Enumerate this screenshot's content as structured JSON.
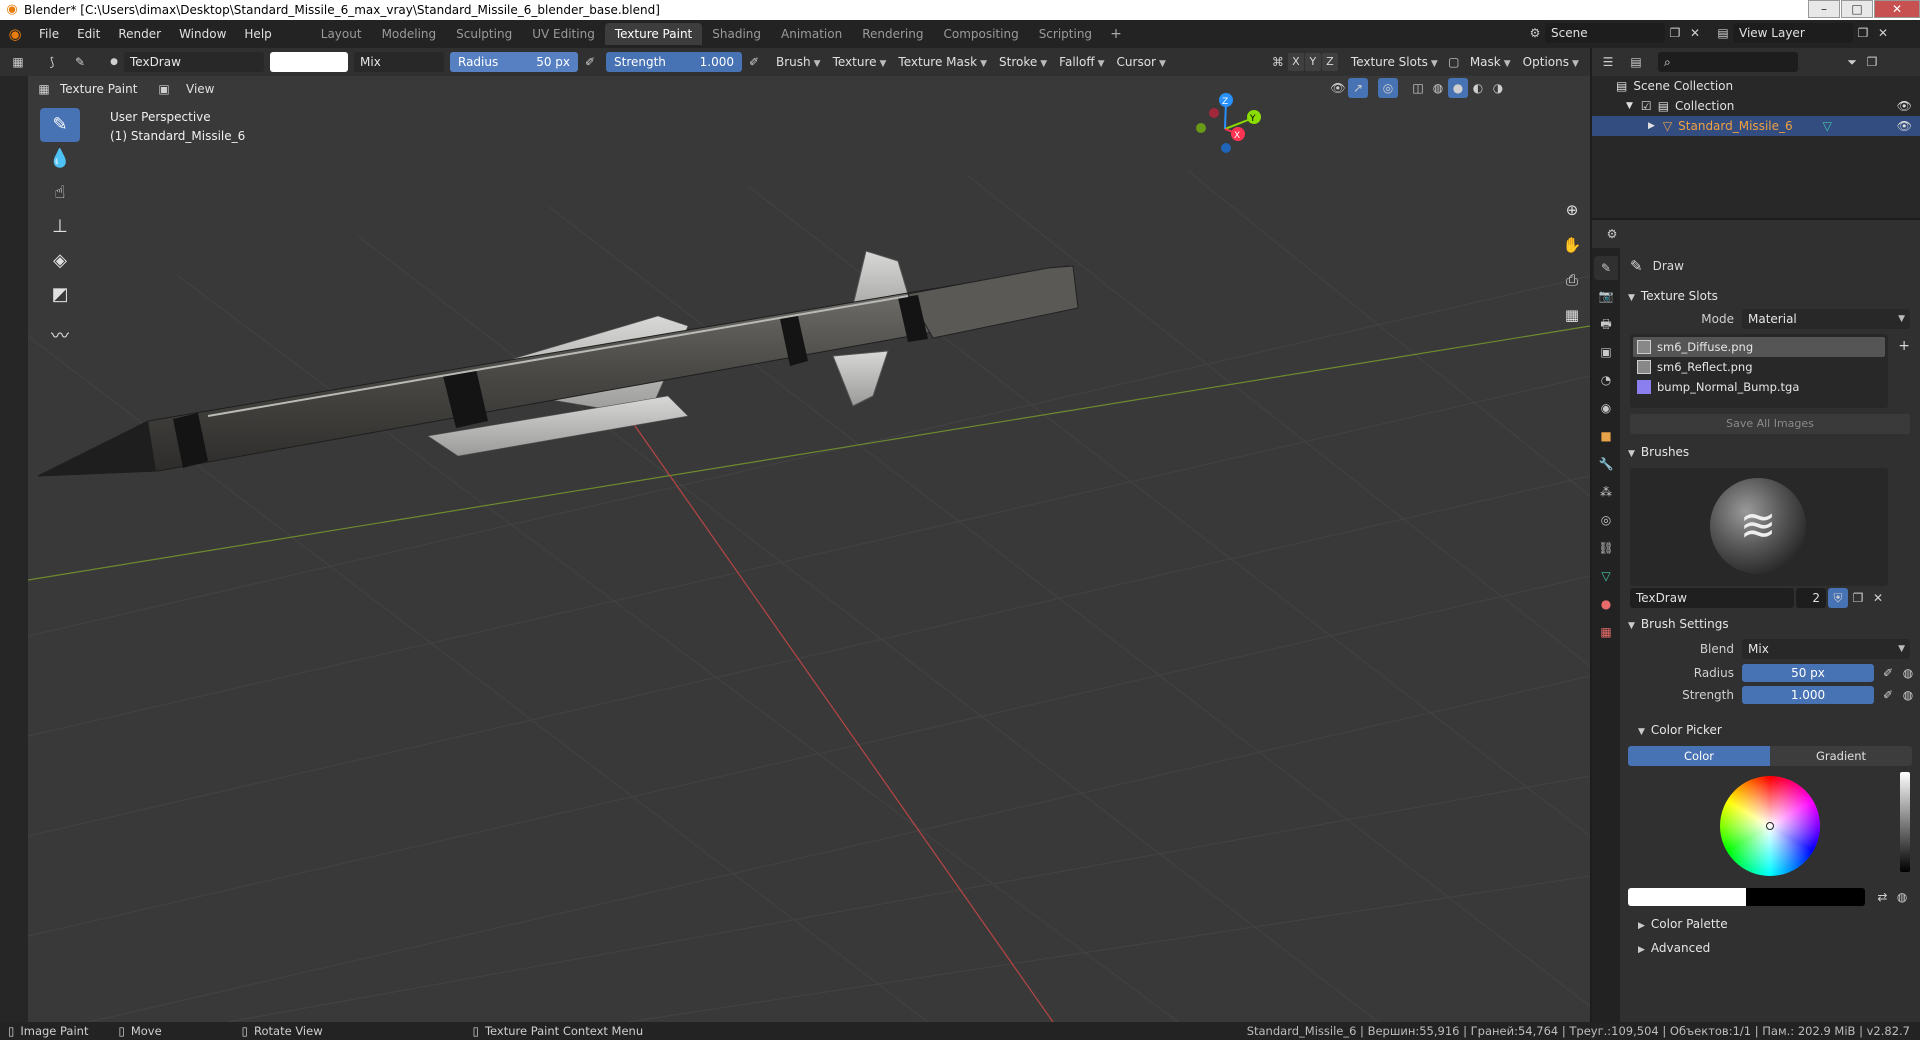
{
  "window": {
    "title": "Blender* [C:\\Users\\dimax\\Desktop\\Standard_Missile_6_max_vray\\Standard_Missile_6_blender_base.blend]",
    "btn_min": "–",
    "btn_max": "□",
    "btn_close": "✕"
  },
  "menu": {
    "items": [
      "File",
      "Edit",
      "Render",
      "Window",
      "Help"
    ]
  },
  "workspaces": {
    "tabs": [
      "Layout",
      "Modeling",
      "Sculpting",
      "UV Editing",
      "Texture Paint",
      "Shading",
      "Animation",
      "Rendering",
      "Compositing",
      "Scripting"
    ],
    "active": "Texture Paint",
    "add": "+"
  },
  "scene": {
    "name": "Scene",
    "view_layer": "View Layer"
  },
  "tool_header": {
    "brush_name": "TexDraw",
    "blend": "Mix",
    "radius_label": "Radius",
    "radius_value": "50 px",
    "strength_label": "Strength",
    "strength_value": "1.000",
    "menus": [
      "Brush",
      "Texture",
      "Texture Mask",
      "Stroke",
      "Falloff",
      "Cursor"
    ],
    "axes": [
      "X",
      "Y",
      "Z"
    ],
    "right_menus": [
      "Texture Slots",
      "Mask",
      "Options"
    ]
  },
  "view_header": {
    "mode": "Texture Paint",
    "view": "View"
  },
  "viewport": {
    "perspective": "User Perspective",
    "object": "(1) Standard_Missile_6",
    "gizmo": {
      "x": "X",
      "y": "Y",
      "z": "Z"
    }
  },
  "outliner": {
    "root": "Scene Collection",
    "collection": "Collection",
    "object": "Standard_Missile_6"
  },
  "properties": {
    "tool_name": "Draw",
    "texture_slots": {
      "title": "Texture Slots",
      "mode_label": "Mode",
      "mode_value": "Material",
      "slots": [
        "sm6_Diffuse.png",
        "sm6_Reflect.png",
        "bump_Normal_Bump.tga"
      ],
      "save_all": "Save All Images"
    },
    "brushes": {
      "title": "Brushes",
      "brush_name": "TexDraw",
      "users": "2"
    },
    "brush_settings": {
      "title": "Brush Settings",
      "blend_label": "Blend",
      "blend_value": "Mix",
      "radius_label": "Radius",
      "radius_value": "50 px",
      "strength_label": "Strength",
      "strength_value": "1.000"
    },
    "color_picker": {
      "title": "Color Picker",
      "tab_color": "Color",
      "tab_gradient": "Gradient"
    },
    "color_palette": "Color Palette",
    "advanced": "Advanced"
  },
  "statusbar": {
    "items": [
      "Image Paint",
      "Move",
      "Rotate View",
      "Texture Paint Context Menu"
    ],
    "stats": "Standard_Missile_6 | Вершин:55,916 | Граней:54,764 | Треуг.:109,504 | Объектов:1/1 | Пам.: 202.9 MiB | v2.82.7"
  },
  "colors": {
    "accent": "#4772b3",
    "selected_row": "#334d80",
    "viewport_bg": "#393939",
    "axis_x": "#ff3352",
    "axis_y": "#8bdc00",
    "axis_z": "#2890ff"
  }
}
